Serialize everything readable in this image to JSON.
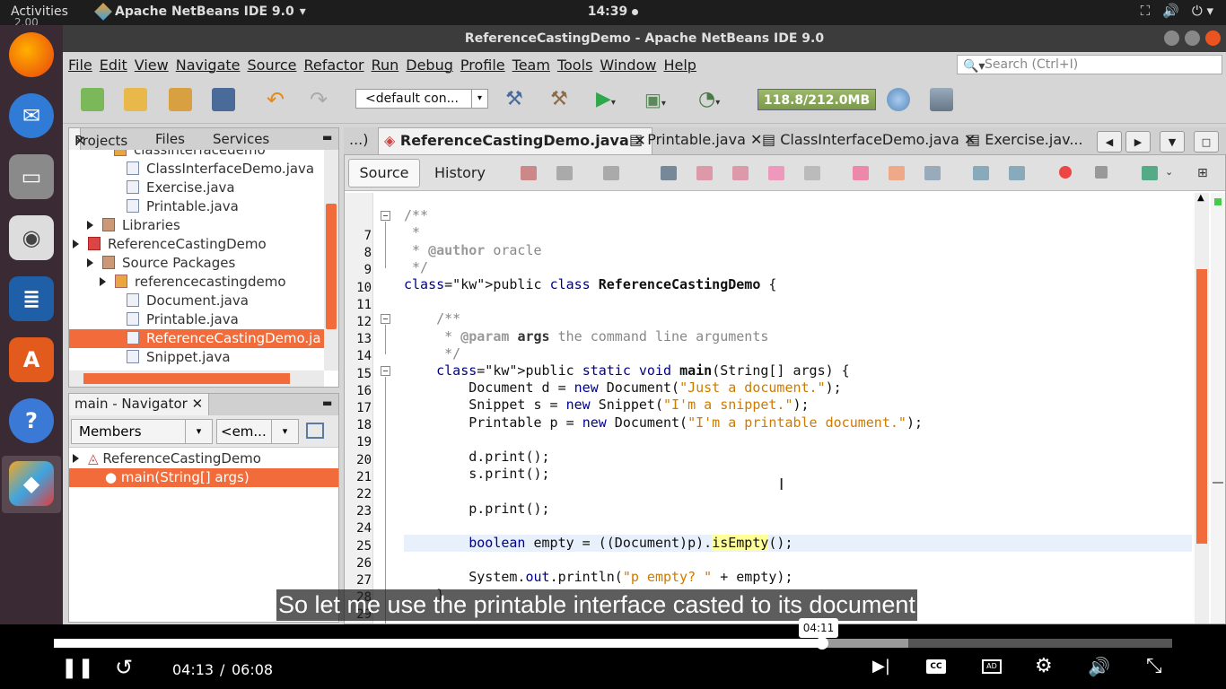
{
  "topbar": {
    "activities": "Activities",
    "app_name": "Apache NetBeans IDE 9.0",
    "clock": "14:39",
    "speed": "2.00"
  },
  "window": {
    "title": "ReferenceCastingDemo - Apache NetBeans IDE 9.0"
  },
  "menu": [
    "File",
    "Edit",
    "View",
    "Navigate",
    "Source",
    "Refactor",
    "Run",
    "Debug",
    "Profile",
    "Team",
    "Tools",
    "Window",
    "Help"
  ],
  "search": {
    "placeholder": "Search (Ctrl+I)"
  },
  "toolbar": {
    "config": "<default con...",
    "memory": "118.8/212.0MB"
  },
  "projects_panel": {
    "tabs": [
      "Projects",
      "Files",
      "Services"
    ],
    "tree": [
      {
        "label": "classinterfacedemo",
        "indent": 3,
        "type": "pkg",
        "partial": true
      },
      {
        "label": "ClassInterfaceDemo.java",
        "indent": 4,
        "type": "file"
      },
      {
        "label": "Exercise.java",
        "indent": 4,
        "type": "file"
      },
      {
        "label": "Printable.java",
        "indent": 4,
        "type": "file"
      },
      {
        "label": "Libraries",
        "indent": 1,
        "type": "folder"
      },
      {
        "label": "ReferenceCastingDemo",
        "indent": 0,
        "type": "project"
      },
      {
        "label": "Source Packages",
        "indent": 1,
        "type": "folder"
      },
      {
        "label": "referencecastingdemo",
        "indent": 2,
        "type": "pkg"
      },
      {
        "label": "Document.java",
        "indent": 4,
        "type": "file"
      },
      {
        "label": "Printable.java",
        "indent": 4,
        "type": "file"
      },
      {
        "label": "ReferenceCastingDemo.ja",
        "indent": 4,
        "type": "file",
        "selected": true
      },
      {
        "label": "Snippet.java",
        "indent": 4,
        "type": "file"
      }
    ]
  },
  "navigator": {
    "tab": "main - Navigator",
    "members": "Members",
    "filter": "<em...",
    "tree": [
      {
        "label": "ReferenceCastingDemo",
        "selected": false
      },
      {
        "label": "main(String[] args)",
        "selected": true
      }
    ]
  },
  "editor_tabs": [
    {
      "label": "...)",
      "active": false
    },
    {
      "label": "ReferenceCastingDemo.java",
      "active": true
    },
    {
      "label": "Printable.java",
      "active": false
    },
    {
      "label": "ClassInterfaceDemo.java",
      "active": false
    },
    {
      "label": "Exercise.jav...",
      "active": false
    }
  ],
  "editor": {
    "source_label": "Source",
    "history_label": "History",
    "lines": [
      {
        "n": "7",
        "text": ""
      },
      {
        "n": "8",
        "text": "/**"
      },
      {
        "n": "9",
        "text": " *"
      },
      {
        "n": "10",
        "text": " * @author oracle"
      },
      {
        "n": "11",
        "text": " */"
      },
      {
        "n": "12",
        "text": "public class ReferenceCastingDemo {"
      },
      {
        "n": "13",
        "text": ""
      },
      {
        "n": "14",
        "text": "    /**"
      },
      {
        "n": "15",
        "text": "     * @param args the command line arguments"
      },
      {
        "n": "16",
        "text": "     */"
      },
      {
        "n": "17",
        "text": "    public static void main(String[] args) {"
      },
      {
        "n": "18",
        "text": "        Document d = new Document(\"Just a document.\");"
      },
      {
        "n": "19",
        "text": "        Snippet s = new Snippet(\"I'm a snippet.\");"
      },
      {
        "n": "20",
        "text": "        Printable p = new Document(\"I'm a printable document.\");"
      },
      {
        "n": "21",
        "text": ""
      },
      {
        "n": "22",
        "text": "        d.print();"
      },
      {
        "n": "23",
        "text": "        s.print();"
      },
      {
        "n": "24",
        "text": ""
      },
      {
        "n": "25",
        "text": "        p.print();"
      },
      {
        "n": "26",
        "text": ""
      },
      {
        "n": "27",
        "text": "        boolean empty = ((Document)p).isEmpty();"
      },
      {
        "n": "28",
        "text": ""
      },
      {
        "n": "29",
        "text": "        System.out.println(\"p empty? \" + empty);"
      },
      {
        "n": "30",
        "text": "    }"
      },
      {
        "n": "31",
        "text": ""
      }
    ]
  },
  "video": {
    "subtitle": "So let me use the printable interface casted to its document",
    "current_time": "04:13",
    "separator": "/",
    "duration": "06:08",
    "hover_time": "04:11",
    "played_fraction": 0.687,
    "buffered_fraction": 0.764
  }
}
